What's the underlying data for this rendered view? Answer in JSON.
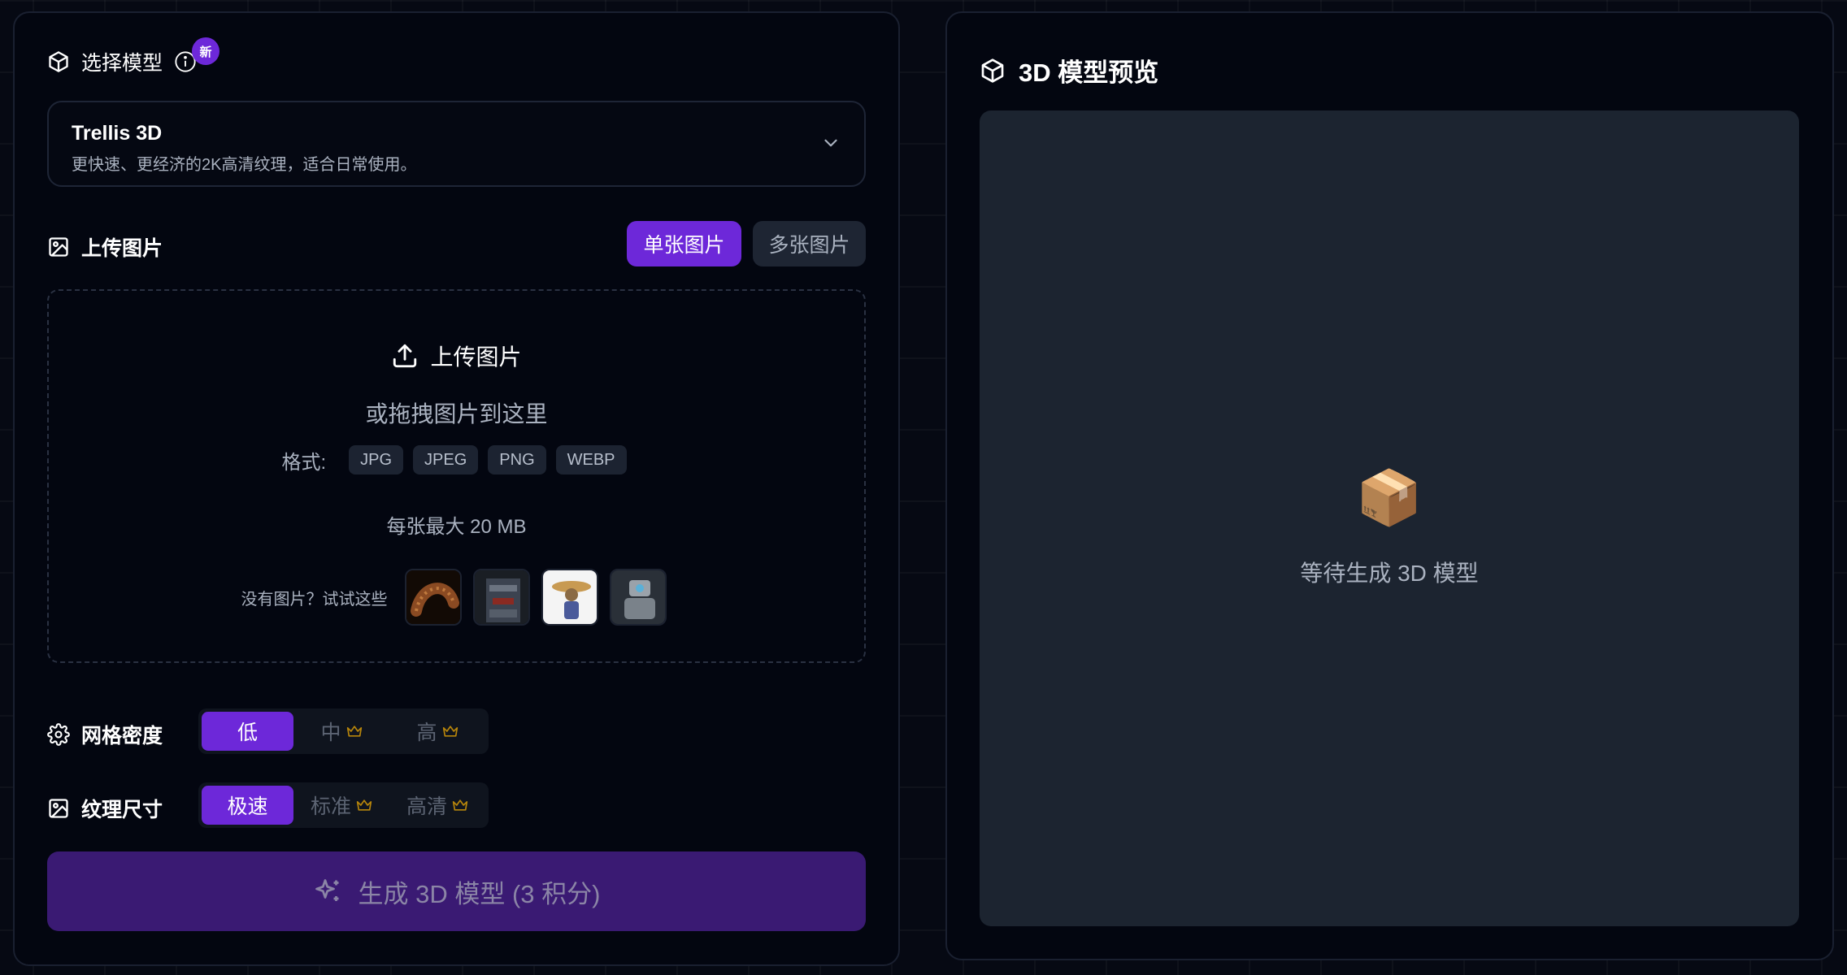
{
  "left": {
    "model_section_title": "选择模型",
    "new_badge": "新",
    "model": {
      "name": "Trellis 3D",
      "description": "更快速、更经济的2K高清纹理，适合日常使用。"
    },
    "upload_section_title": "上传图片",
    "upload_modes": [
      "单张图片",
      "多张图片"
    ],
    "dropzone": {
      "upload_label": "上传图片",
      "drag_hint": "或拖拽图片到这里",
      "format_label": "格式:",
      "formats": [
        "JPG",
        "JPEG",
        "PNG",
        "WEBP"
      ],
      "size_limit": "每张最大 20 MB",
      "samples_hint": "没有图片？试试这些"
    },
    "mesh_density": {
      "title": "网格密度",
      "options": [
        "低",
        "中",
        "高"
      ]
    },
    "texture_size": {
      "title": "纹理尺寸",
      "options": [
        "极速",
        "标准",
        "高清"
      ]
    },
    "generate_label": "生成 3D 模型 (3 积分)"
  },
  "right": {
    "title": "3D 模型预览",
    "empty_icon": "📦",
    "empty_text": "等待生成 3D 模型"
  },
  "colors": {
    "accent": "#6d28d9",
    "crown": "#b8860b"
  }
}
